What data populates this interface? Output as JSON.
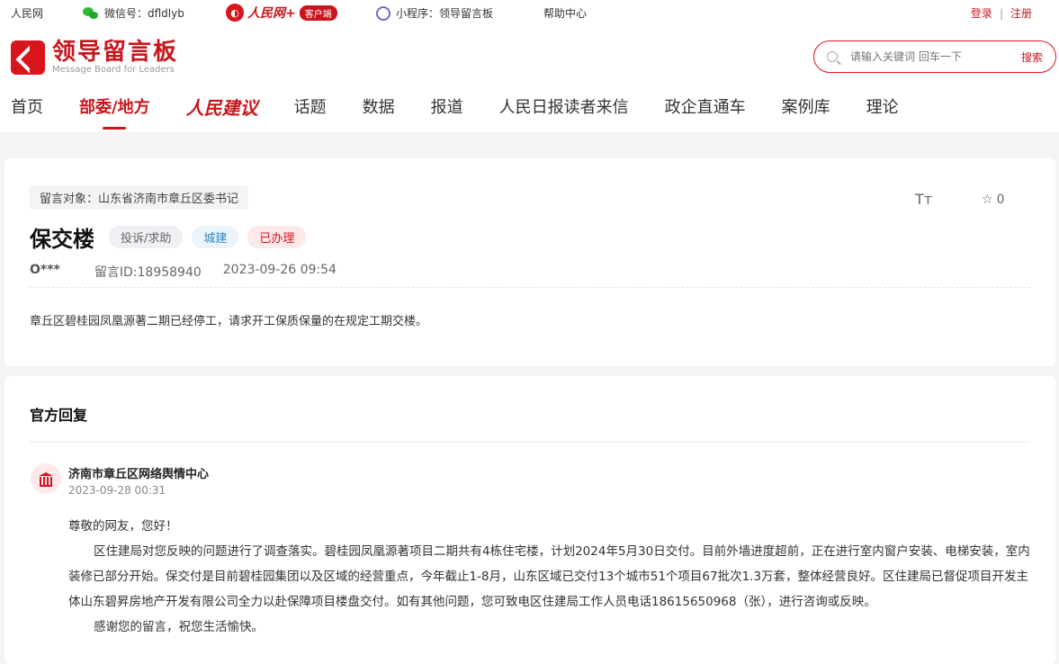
{
  "topbar": {
    "rmw": "人民网",
    "wechat": "微信号：dfldlyb",
    "client_name": "人民网+",
    "client_badge": "客户端",
    "mini": "小程序：领导留言板",
    "help": "帮助中心",
    "login": "登录",
    "divider": "|",
    "register": "注册"
  },
  "header": {
    "logo_cn": "领导留言板",
    "logo_en": "Message Board for Leaders",
    "search_placeholder": "请输入关键词 回车一下",
    "search_btn": "搜索"
  },
  "nav": [
    "首页",
    "部委/地方",
    "人民建议",
    "话题",
    "数据",
    "报道",
    "人民日报读者来信",
    "政企直通车",
    "案例库",
    "理论"
  ],
  "message": {
    "target": "留言对象：山东省济南市章丘区委书记",
    "font_icon": "Tт",
    "fav_count": "0",
    "title": "保交楼",
    "tags": [
      "投诉/求助",
      "城建",
      "已办理"
    ],
    "user": "O***",
    "id": "留言ID:18958940",
    "time": "2023-09-26 09:54",
    "content": "章丘区碧桂园凤凰源著二期已经停工，请求开工保质保量的在规定工期交楼。"
  },
  "reply": {
    "heading": "官方回复",
    "org": "济南市章丘区网络舆情中心",
    "time": "2023-09-28 00:31",
    "greeting": "尊敬的网友，您好！",
    "body": "区住建局对您反映的问题进行了调查落实。碧桂园凤凰源著项目二期共有4栋住宅楼，计划2024年5月30日交付。目前外墙进度超前，正在进行室内窗户安装、电梯安装，室内装修已部分开始。保交付是目前碧桂园集团以及区域的经营重点，今年截止1-8月，山东区域已交付13个城市51个项目67批次1.3万套，整体经营良好。区住建局已督促项目开发主体山东碧昇房地产开发有限公司全力以赴保障项目楼盘交付。如有其他问题，您可致电区住建局工作人员电话18615650968（张），进行咨询或反映。",
    "closing": "感谢您的留言，祝您生活愉快。"
  }
}
